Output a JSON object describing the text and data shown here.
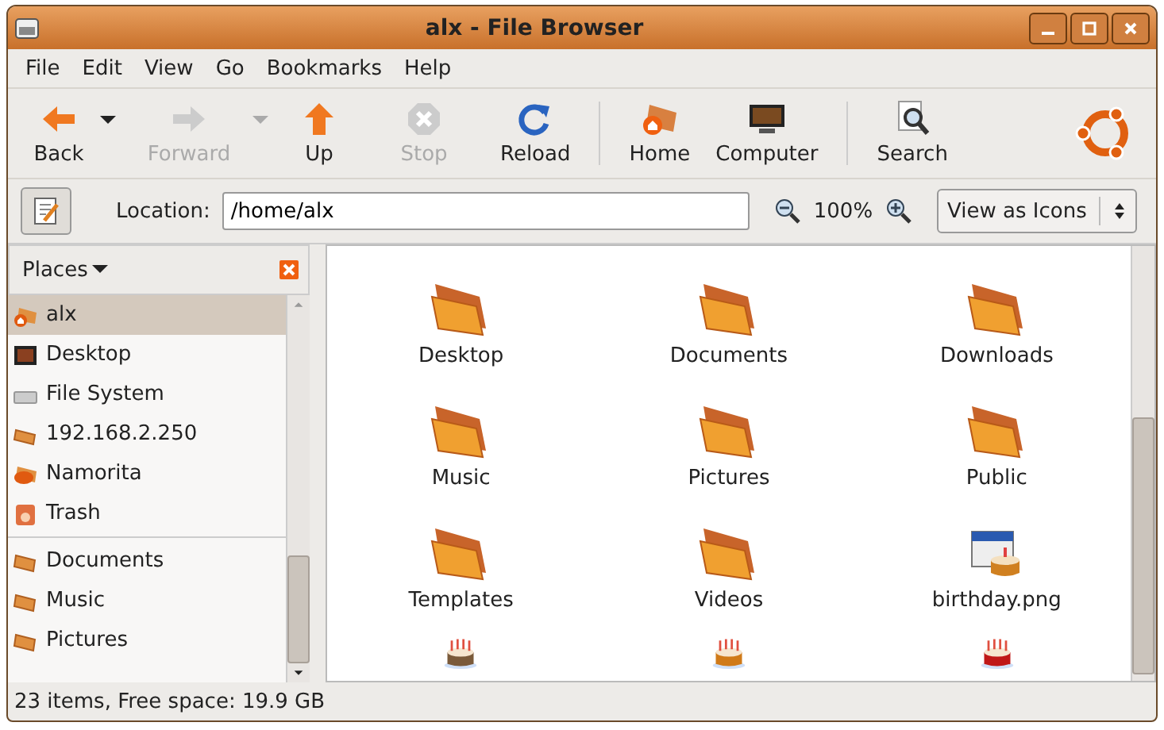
{
  "window": {
    "title": "alx - File Browser"
  },
  "menu": [
    "File",
    "Edit",
    "View",
    "Go",
    "Bookmarks",
    "Help"
  ],
  "toolbar": {
    "groups": [
      [
        {
          "kind": "back",
          "label": "Back",
          "disabled": false,
          "has_menu": true
        },
        {
          "kind": "forward",
          "label": "Forward",
          "disabled": true,
          "has_menu": true
        },
        {
          "kind": "up",
          "label": "Up",
          "disabled": false,
          "has_menu": false
        },
        {
          "kind": "stop",
          "label": "Stop",
          "disabled": true,
          "has_menu": false
        },
        {
          "kind": "reload",
          "label": "Reload",
          "disabled": false,
          "has_menu": false
        }
      ],
      [
        {
          "kind": "home",
          "label": "Home",
          "disabled": false,
          "has_menu": false
        },
        {
          "kind": "computer",
          "label": "Computer",
          "disabled": false,
          "has_menu": false
        }
      ],
      [
        {
          "kind": "search",
          "label": "Search",
          "disabled": false,
          "has_menu": false
        }
      ]
    ]
  },
  "location": {
    "label": "Location:",
    "value": "/home/alx",
    "zoom": "100%",
    "view": "View as Icons"
  },
  "sidebar": {
    "title": "Places",
    "groups": [
      [
        {
          "kind": "home",
          "label": "alx",
          "selected": true
        },
        {
          "kind": "desktop",
          "label": "Desktop",
          "selected": false
        },
        {
          "kind": "drive",
          "label": "File System",
          "selected": false
        },
        {
          "kind": "network",
          "label": "192.168.2.250",
          "selected": false
        },
        {
          "kind": "ssh",
          "label": "Namorita",
          "selected": false
        },
        {
          "kind": "trash",
          "label": "Trash",
          "selected": false
        }
      ],
      [
        {
          "kind": "folder",
          "label": "Documents",
          "selected": false
        },
        {
          "kind": "folder",
          "label": "Music",
          "selected": false
        },
        {
          "kind": "folder",
          "label": "Pictures",
          "selected": false
        }
      ]
    ]
  },
  "files": [
    {
      "kind": "folder",
      "name": "Desktop"
    },
    {
      "kind": "folder",
      "name": "Documents"
    },
    {
      "kind": "folder",
      "name": "Downloads"
    },
    {
      "kind": "folder",
      "name": "Music"
    },
    {
      "kind": "folder",
      "name": "Pictures"
    },
    {
      "kind": "folder",
      "name": "Public"
    },
    {
      "kind": "folder",
      "name": "Templates"
    },
    {
      "kind": "folder",
      "name": "Videos"
    },
    {
      "kind": "calendar",
      "name": "birthday.png"
    },
    {
      "kind": "cake",
      "color": "#7a5a3a"
    },
    {
      "kind": "cake",
      "color": "#d07a18"
    },
    {
      "kind": "cake",
      "color": "#c01818"
    }
  ],
  "status_bar": "23 items, Free space: 19.9 GB"
}
